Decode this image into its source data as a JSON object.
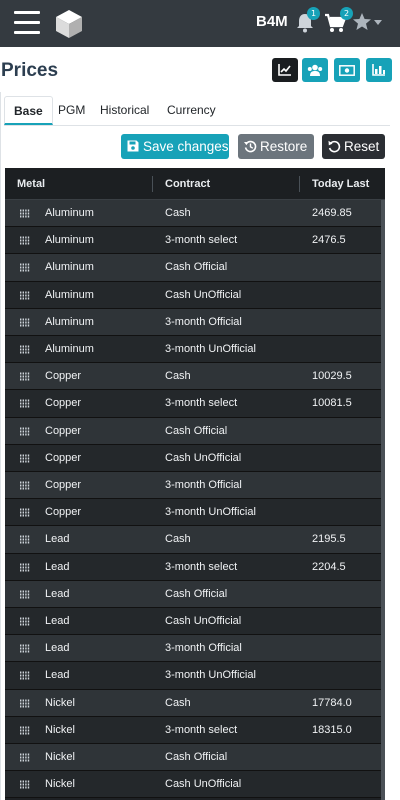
{
  "topbar": {
    "brand": "B4M",
    "notifications_count": "1",
    "cart_count": "2",
    "icons": [
      "hamburger-icon",
      "cube-logo-icon",
      "bell-icon",
      "cart-icon",
      "star-icon",
      "caret-down-icon"
    ]
  },
  "header": {
    "title": "Prices",
    "buttons": [
      "chart-icon",
      "users-icon",
      "money-icon",
      "bar-chart-icon"
    ]
  },
  "tabs": [
    {
      "label": "Base",
      "active": true
    },
    {
      "label": "PGM",
      "active": false
    },
    {
      "label": "Historical",
      "active": false
    },
    {
      "label": "Currency",
      "active": false
    }
  ],
  "actions": {
    "save": "Save changes",
    "restore": "Restore",
    "reset": "Reset"
  },
  "table": {
    "columns": [
      "Metal",
      "Contract",
      "Today Last"
    ],
    "rows": [
      {
        "metal": "Aluminum",
        "contract": "Cash",
        "last": "2469.85"
      },
      {
        "metal": "Aluminum",
        "contract": "3-month select",
        "last": "2476.5"
      },
      {
        "metal": "Aluminum",
        "contract": "Cash Official",
        "last": ""
      },
      {
        "metal": "Aluminum",
        "contract": "Cash UnOfficial",
        "last": ""
      },
      {
        "metal": "Aluminum",
        "contract": "3-month Official",
        "last": ""
      },
      {
        "metal": "Aluminum",
        "contract": "3-month UnOfficial",
        "last": ""
      },
      {
        "metal": "Copper",
        "contract": "Cash",
        "last": "10029.5"
      },
      {
        "metal": "Copper",
        "contract": "3-month select",
        "last": "10081.5"
      },
      {
        "metal": "Copper",
        "contract": "Cash Official",
        "last": ""
      },
      {
        "metal": "Copper",
        "contract": "Cash UnOfficial",
        "last": ""
      },
      {
        "metal": "Copper",
        "contract": "3-month Official",
        "last": ""
      },
      {
        "metal": "Copper",
        "contract": "3-month UnOfficial",
        "last": ""
      },
      {
        "metal": "Lead",
        "contract": "Cash",
        "last": "2195.5"
      },
      {
        "metal": "Lead",
        "contract": "3-month select",
        "last": "2204.5"
      },
      {
        "metal": "Lead",
        "contract": "Cash Official",
        "last": ""
      },
      {
        "metal": "Lead",
        "contract": "Cash UnOfficial",
        "last": ""
      },
      {
        "metal": "Lead",
        "contract": "3-month Official",
        "last": ""
      },
      {
        "metal": "Lead",
        "contract": "3-month UnOfficial",
        "last": ""
      },
      {
        "metal": "Nickel",
        "contract": "Cash",
        "last": "17784.0"
      },
      {
        "metal": "Nickel",
        "contract": "3-month select",
        "last": "18315.0"
      },
      {
        "metal": "Nickel",
        "contract": "Cash Official",
        "last": ""
      },
      {
        "metal": "Nickel",
        "contract": "Cash UnOfficial",
        "last": ""
      }
    ]
  },
  "colors": {
    "accent": "#17a2b8",
    "topbar": "#343a40",
    "table_bg": "#24282b"
  }
}
